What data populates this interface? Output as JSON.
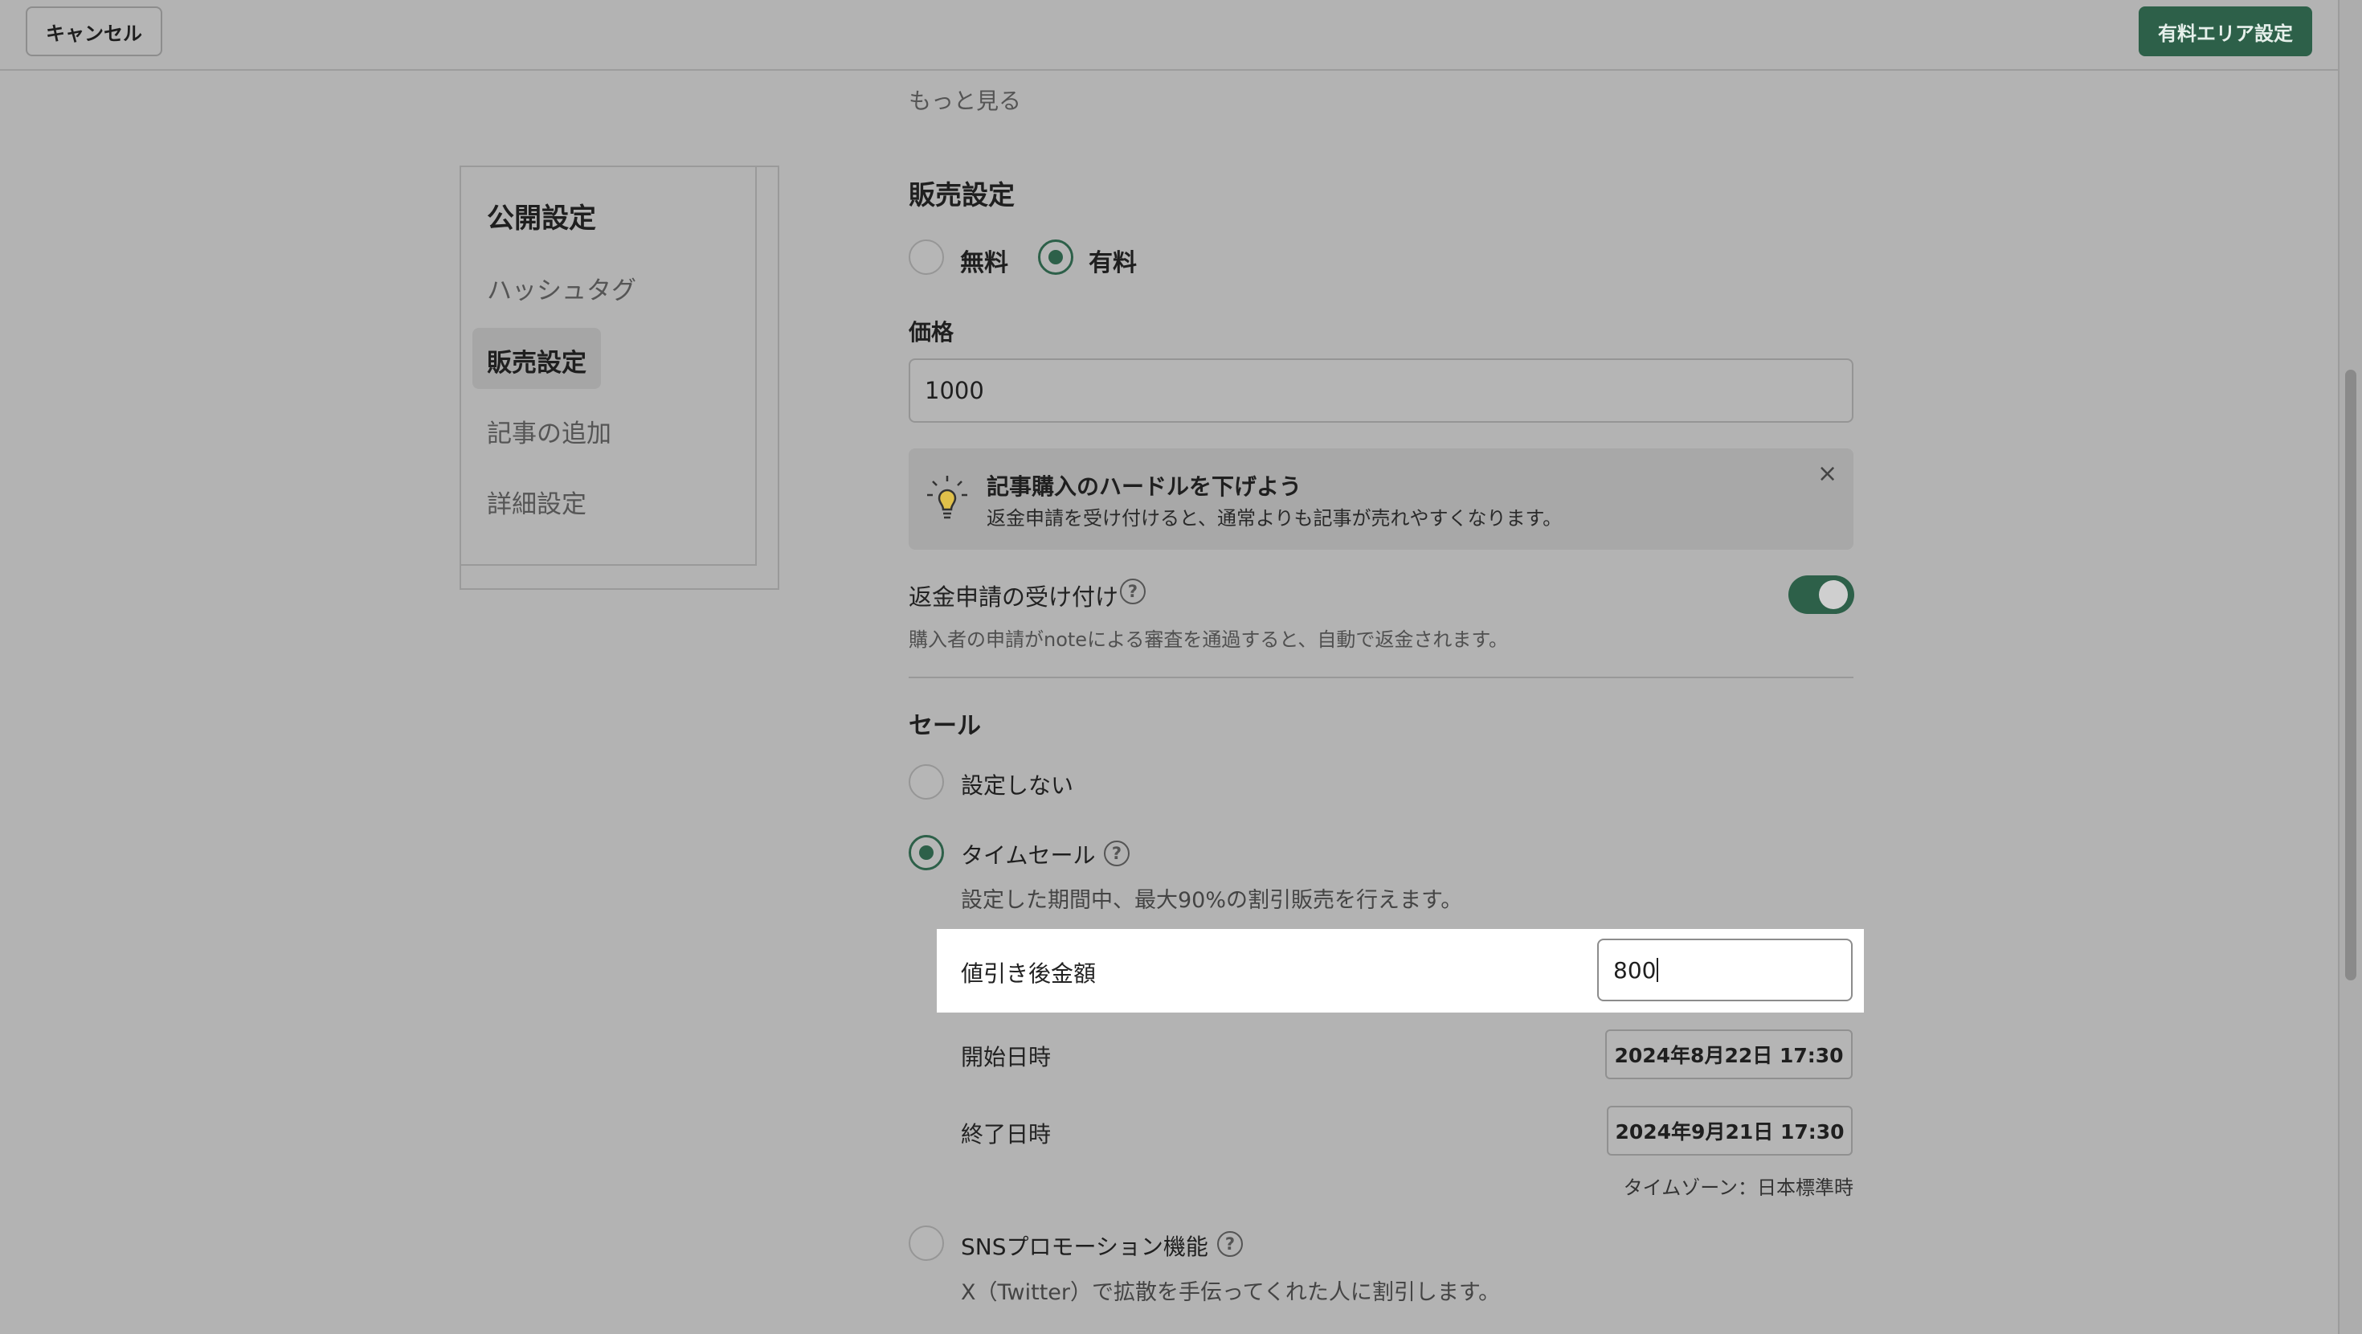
{
  "header": {
    "cancel_label": "キャンセル",
    "paid_area_label": "有料エリア設定"
  },
  "more_link": "もっと見る",
  "sidebar": {
    "title": "公開設定",
    "items": [
      {
        "label": "ハッシュタグ"
      },
      {
        "label": "販売設定"
      },
      {
        "label": "記事の追加"
      },
      {
        "label": "詳細設定"
      }
    ]
  },
  "sales": {
    "title": "販売設定",
    "free_label": "無料",
    "paid_label": "有料",
    "selected": "有料",
    "price_label": "価格",
    "price_value": "1000"
  },
  "tip": {
    "title": "記事購入のハードルを下げよう",
    "text": "返金申請を受け付けると、通常よりも記事が売れやすくなります。",
    "close": "×"
  },
  "refund": {
    "label": "返金申請の受け付け",
    "help": "?",
    "enabled": true,
    "description": "購入者の申請がnoteによる審査を通過すると、自動で返金されます。"
  },
  "sale": {
    "title": "セール",
    "none_label": "設定しない",
    "time_sale_label": "タイムセール",
    "time_sale_desc": "設定した期間中、最大90%の割引販売を行えます。",
    "discount_label": "値引き後金額",
    "discount_value": "800",
    "start_label": "開始日時",
    "start_value": "2024年8月22日 17:30",
    "end_label": "終了日時",
    "end_value": "2024年9月21日 17:30",
    "timezone": "タイムゾーン：日本標準時",
    "sns_label": "SNSプロモーション機能",
    "sns_desc": "X（Twitter）で拡散を手伝ってくれた人に割引します。"
  },
  "colors": {
    "accent": "#2d6049",
    "overlay_bg": "#b3b3b3"
  }
}
